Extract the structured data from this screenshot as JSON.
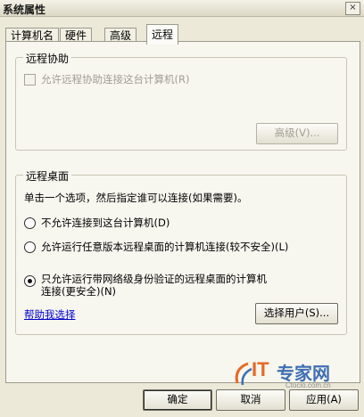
{
  "window": {
    "title": "系统属性",
    "close_symbol": "×"
  },
  "tabs": [
    {
      "label": "计算机名"
    },
    {
      "label": "硬件"
    },
    {
      "label": "高级"
    },
    {
      "label": "远程",
      "active": true
    }
  ],
  "remote_assistance": {
    "group_title": "远程协助",
    "checkbox_label": "允许远程协助连接这台计算机(R)",
    "checked": false,
    "enabled": false,
    "advanced_button": "高级(V)..."
  },
  "remote_desktop": {
    "group_title": "远程桌面",
    "instruction": "单击一个选项，然后指定谁可以连接(如果需要)。",
    "options": [
      {
        "label": "不允许连接到这台计算机(D)",
        "checked": false
      },
      {
        "label": "允许运行任意版本远程桌面的计算机连接(较不安全)(L)",
        "checked": false
      },
      {
        "label_line1": "只允许运行带网络级身份验证的远程桌面的计算机",
        "label_line2": "连接(更安全)(N)",
        "checked": true
      }
    ],
    "help_link": "帮助我选择",
    "select_users_button": "选择用户(S)..."
  },
  "footer": {
    "ok": "确定",
    "cancel": "取消",
    "apply": "应用(A)"
  },
  "watermark": {
    "text_it": "IT",
    "text_cn": "专家网",
    "subtext": "Ctocio.com.cn"
  },
  "colors": {
    "background": "#ece9d8",
    "panel": "#f7f6ef",
    "link": "#0000cc",
    "watermark_orange": "#e46a24",
    "watermark_blue": "#3f6fb2"
  }
}
